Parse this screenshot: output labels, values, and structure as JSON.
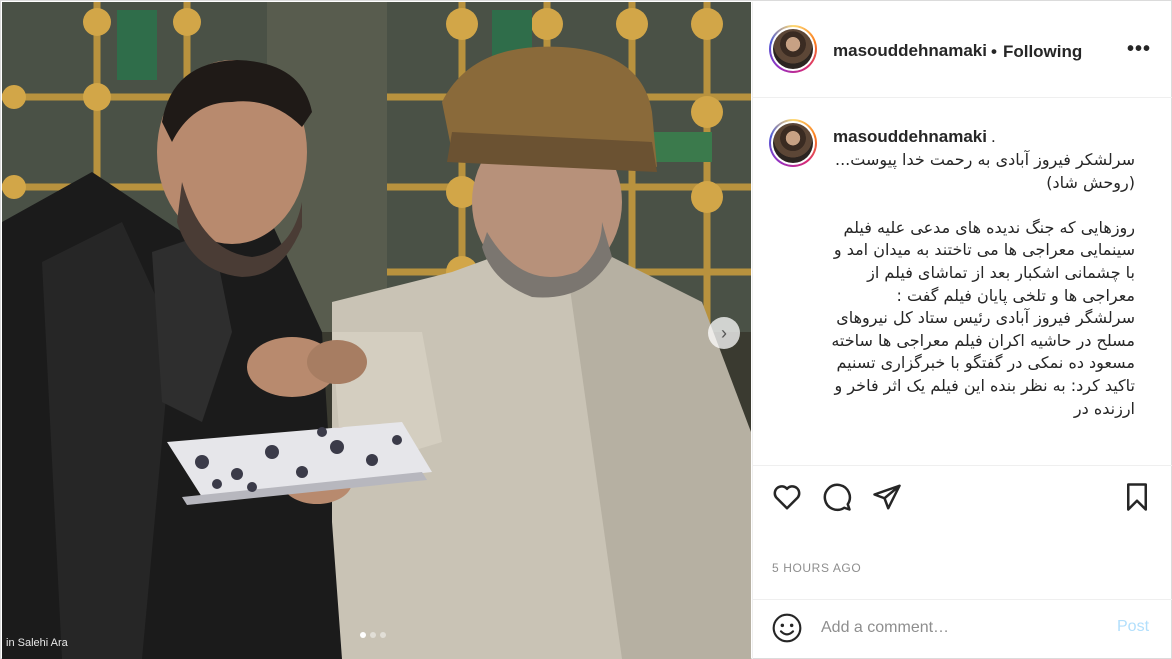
{
  "post": {
    "username": "masouddehnamaki",
    "follow_separator": "•",
    "follow_status": "Following",
    "more_icon": "ellipsis-icon",
    "photo_credit": "in Salehi Ara",
    "carousel_next_icon": "chevron-right-icon",
    "carousel_dots": 3,
    "carousel_active_index": 0
  },
  "caption": {
    "username": "masouddehnamaki",
    "trailing": ".",
    "text": "سرلشکر فیروز آبادی به رحمت خدا پیوست...\n(روحش شاد)\n\nروزهایی که جنگ ندیده های مدعی علیه فیلم سینمایی معراجی ها می تاختند به میدان امد و با چشمانی اشکبار بعد از تماشای فیلم از معراجی ها و تلخی پایان فیلم گفت :\nسرلشگر فیروز آبادی رئیس ستاد کل نیروهای مسلح در حاشیه اکران فیلم معراجی ها ساخته مسعود ده نمکی در گفتگو با خبرگزاری تسنیم تاکید کرد: به نظر بنده این فیلم یک اثر فاخر و ارزنده در"
  },
  "actions": {
    "like_icon": "heart-icon",
    "comment_icon": "comment-icon",
    "share_icon": "paper-plane-icon",
    "save_icon": "bookmark-icon"
  },
  "timestamp": "5 HOURS AGO",
  "comment_box": {
    "emoji_icon": "smiley-icon",
    "placeholder": "Add a comment…",
    "post_label": "Post"
  },
  "colors": {
    "link_disabled": "#b2dffc",
    "muted": "#8e8e8e",
    "border": "#efefef"
  }
}
